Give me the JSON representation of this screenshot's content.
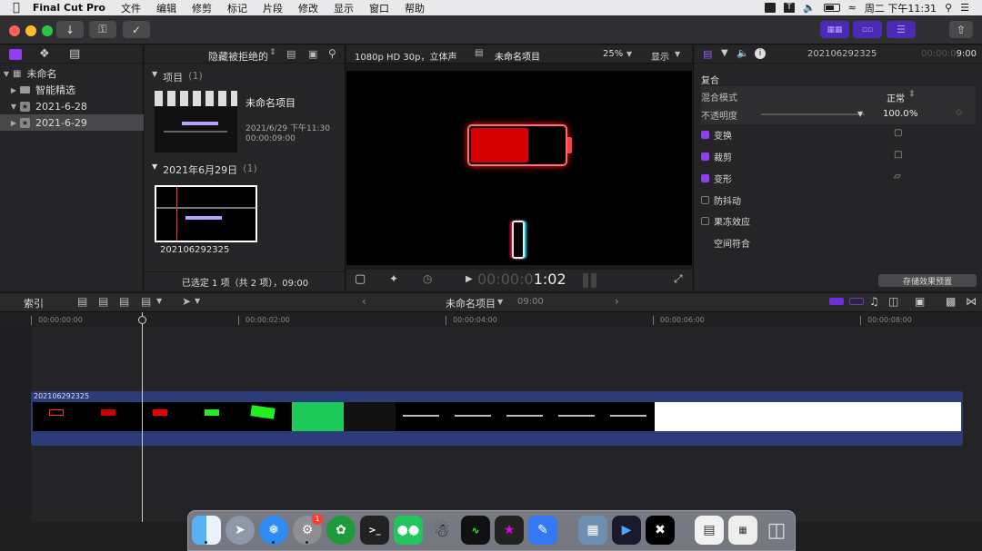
{
  "menubar": {
    "app": "Final Cut Pro",
    "items": [
      "文件",
      "编辑",
      "修剪",
      "标记",
      "片段",
      "修改",
      "显示",
      "窗口",
      "帮助"
    ],
    "datetime": "周二 下午11:31"
  },
  "library": {
    "name": "未命名",
    "items": [
      {
        "label": "智能精选"
      },
      {
        "label": "2021-6-28"
      },
      {
        "label": "2021-6-29"
      }
    ]
  },
  "browser": {
    "filter": "隐藏被拒绝的",
    "section_projects": "项目",
    "section_projects_count": "(1)",
    "project_name": "未命名项目",
    "project_date": "2021/6/29 下午11:30",
    "project_duration": "00:00:09:00",
    "section_date": "2021年6月29日",
    "section_date_count": "(1)",
    "clip_name": "202106292325",
    "status": "已选定 1 项（共 2 项），09:00"
  },
  "viewer": {
    "format": "1080p HD 30p，立体声",
    "title": "未命名项目",
    "zoom": "25%",
    "display": "显示",
    "timecode_dim": "00:00:0",
    "timecode": "1:02",
    "battery_level": 0.62
  },
  "inspector": {
    "clip_name": "202106292325",
    "timecode_dim": "00:00:0",
    "timecode": "9:00",
    "composite": "复合",
    "blend_mode_label": "混合模式",
    "blend_mode_value": "正常",
    "opacity_label": "不透明度",
    "opacity_value": "100.0",
    "opacity_unit": "%",
    "rows": [
      {
        "label": "变换",
        "checked": true
      },
      {
        "label": "裁剪",
        "checked": true
      },
      {
        "label": "变形",
        "checked": true
      },
      {
        "label": "防抖动",
        "checked": false
      },
      {
        "label": "果冻效应",
        "checked": false
      }
    ],
    "spatial": "空间符合",
    "save_preset": "存储效果预置"
  },
  "timeline": {
    "index": "索引",
    "project": "未命名项目",
    "duration": "09:00",
    "ruler": [
      "00:00:00:00",
      "00:00:02:00",
      "00:00:04:00",
      "00:00:06:00",
      "00:00:08:00"
    ],
    "clip_name": "202106292325"
  },
  "dock": {
    "badge": "1",
    "apps": [
      "finder",
      "launchpad",
      "safari",
      "system-preferences",
      "unknown-green",
      "terminal",
      "wechat",
      "qq",
      "activity-monitor",
      "final-cut-pro",
      "pages-pen",
      "preview",
      "screen-recorder",
      "capcut",
      "document",
      "calendar",
      "trash"
    ]
  }
}
